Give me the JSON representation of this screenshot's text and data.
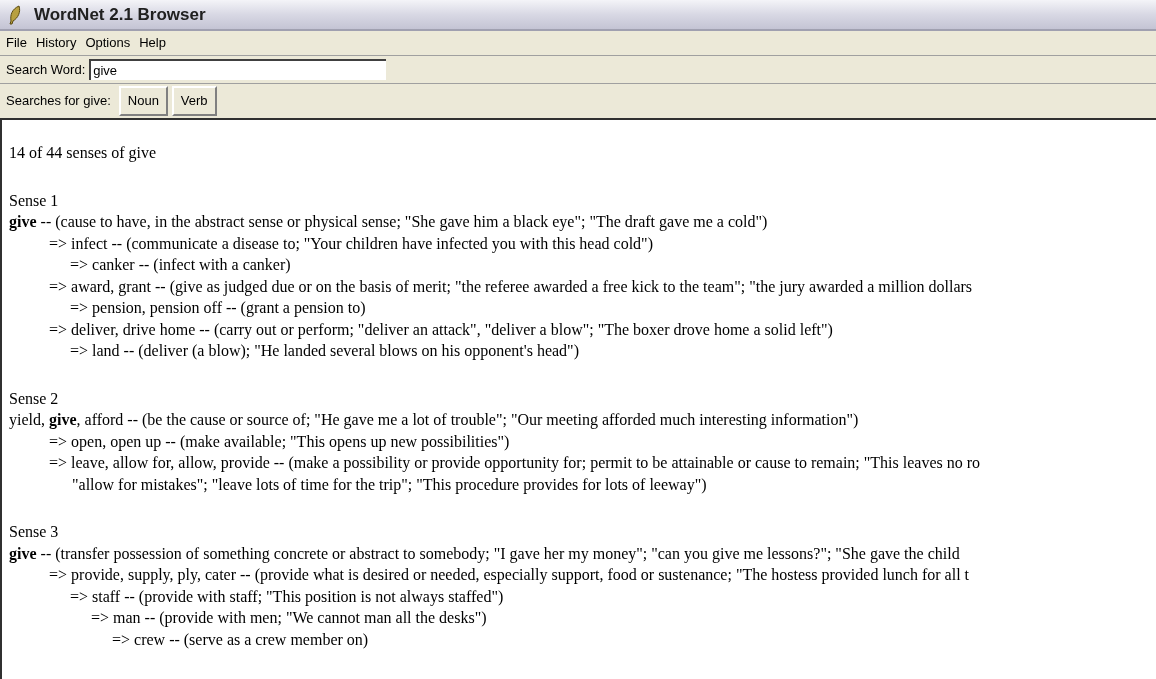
{
  "window": {
    "title": "WordNet 2.1 Browser"
  },
  "menu": [
    "File",
    "History",
    "Options",
    "Help"
  ],
  "search": {
    "label": "Search Word:",
    "value": "give"
  },
  "searches": {
    "label": "Searches for give:",
    "buttons": [
      "Noun",
      "Verb"
    ]
  },
  "summary": "14 of 44 senses of give",
  "senses": [
    {
      "heading": "Sense 1",
      "entries": [
        {
          "text": "**give** -- (cause to have, in the abstract sense or physical sense; \"She gave him a black eye\"; \"The draft gave me a cold\")",
          "children": [
            {
              "text": "=> infect -- (communicate a disease to; \"Your children have infected you with this head cold\")",
              "children": [
                {
                  "text": "=> canker -- (infect with a canker)"
                }
              ]
            },
            {
              "text": "=> award, grant -- (give as judged due or on the basis of merit; \"the referee awarded a free kick to the team\"; \"the jury awarded a million dollars",
              "children": [
                {
                  "text": "=> pension, pension off -- (grant a pension to)"
                }
              ]
            },
            {
              "text": "=> deliver, drive home -- (carry out or perform; \"deliver an attack\", \"deliver a blow\"; \"The boxer drove home a solid left\")",
              "children": [
                {
                  "text": "=> land -- (deliver (a blow); \"He landed several blows on his opponent's head\")"
                }
              ]
            }
          ]
        }
      ]
    },
    {
      "heading": "Sense 2",
      "entries": [
        {
          "text": "yield, **give**, afford -- (be the cause or source of; \"He gave me a lot of trouble\"; \"Our meeting afforded much interesting information\")",
          "children": [
            {
              "text": "=> open, open up -- (make available; \"This opens up new possibilities\")"
            },
            {
              "text": "=> leave, allow for, allow, provide -- (make a possibility or provide opportunity for; permit to be attainable or cause to remain; \"This leaves no ro",
              "continuation": "\"allow for mistakes\"; \"leave lots of time for the trip\"; \"This procedure provides for lots of leeway\")"
            }
          ]
        }
      ]
    },
    {
      "heading": "Sense 3",
      "entries": [
        {
          "text": "**give** -- (transfer possession of something concrete or abstract to somebody; \"I gave her my money\"; \"can you give me lessons?\"; \"She gave the child",
          "children": [
            {
              "text": "=> provide, supply, ply, cater -- (provide what is desired or needed, especially support, food or sustenance; \"The hostess provided lunch for all t",
              "children": [
                {
                  "text": "=> staff -- (provide with staff; \"This position is not always staffed\")",
                  "children": [
                    {
                      "text": "=> man -- (provide with men; \"We cannot man all the desks\")",
                      "children": [
                        {
                          "text": "=> crew -- (serve as a crew member on)"
                        }
                      ]
                    }
                  ]
                }
              ]
            }
          ]
        }
      ]
    }
  ]
}
